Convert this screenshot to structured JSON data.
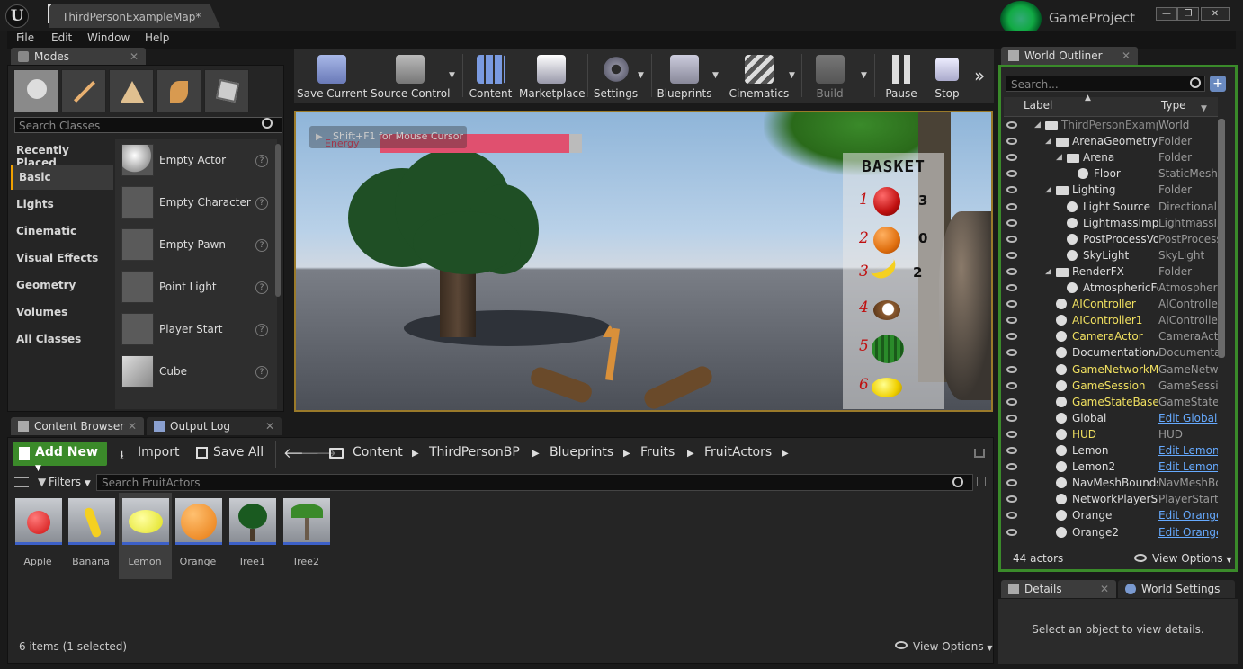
{
  "window": {
    "doc_tab": "ThirdPersonExampleMap*",
    "project": "GameProject",
    "controls": [
      "—",
      "❐",
      "✕"
    ]
  },
  "menu": [
    "File",
    "Edit",
    "Window",
    "Help"
  ],
  "modes": {
    "tab": "Modes",
    "search_placeholder": "Search Classes",
    "categories": [
      "Recently Placed",
      "Basic",
      "Lights",
      "Cinematic",
      "Visual Effects",
      "Geometry",
      "Volumes",
      "All Classes"
    ],
    "selected_category": "Basic",
    "items": [
      "Empty Actor",
      "Empty Character",
      "Empty Pawn",
      "Point Light",
      "Player Start",
      "Cube"
    ]
  },
  "toolbar": {
    "buttons": [
      "Save Current",
      "Source Control",
      "Content",
      "Marketplace",
      "Settings",
      "Blueprints",
      "Cinematics",
      "Build",
      "Pause",
      "Stop"
    ]
  },
  "viewport": {
    "hint": "Shift+F1 for Mouse Cursor",
    "energy_label": "Energy",
    "energy_level": 0.96,
    "basket": {
      "title": "BASKET",
      "rows": [
        {
          "num": "1",
          "count": "3",
          "fruit": "apple"
        },
        {
          "num": "2",
          "count": "0",
          "fruit": "orange"
        },
        {
          "num": "3",
          "count": "2",
          "fruit": "banana"
        },
        {
          "num": "4",
          "count": "",
          "fruit": "coconut"
        },
        {
          "num": "5",
          "count": "",
          "fruit": "watermelon"
        },
        {
          "num": "6",
          "count": "",
          "fruit": "lemon"
        }
      ]
    }
  },
  "content_browser": {
    "tabs": [
      "Content Browser",
      "Output Log"
    ],
    "add_new": "Add New",
    "import": "Import",
    "save_all": "Save All",
    "breadcrumb": [
      "Content",
      "ThirdPersonBP",
      "Blueprints",
      "Fruits",
      "FruitActors"
    ],
    "filters": "Filters",
    "search_placeholder": "Search FruitActors",
    "assets": [
      "Apple",
      "Banana",
      "Lemon",
      "Orange",
      "Tree1",
      "Tree2"
    ],
    "selected_asset": "Lemon",
    "status": "6 items (1 selected)",
    "view_options": "View Options"
  },
  "outliner": {
    "tab": "World Outliner",
    "search_placeholder": "Search...",
    "col_label": "Label",
    "col_type": "Type",
    "rows": [
      {
        "label": "ThirdPersonExampleMap",
        "type": "World",
        "indent": 3,
        "dim": true
      },
      {
        "label": "ArenaGeometry",
        "type": "Folder",
        "indent": 4
      },
      {
        "label": "Arena",
        "type": "Folder",
        "indent": 5
      },
      {
        "label": "Floor",
        "type": "StaticMeshActor",
        "indent": 6
      },
      {
        "label": "Lighting",
        "type": "Folder",
        "indent": 4
      },
      {
        "label": "Light Source",
        "type": "DirectionalLight",
        "indent": 5
      },
      {
        "label": "LightmassImportanceVolume",
        "type": "LightmassImportanceVolume",
        "indent": 5
      },
      {
        "label": "PostProcessVolume",
        "type": "PostProcessVolume",
        "indent": 5
      },
      {
        "label": "SkyLight",
        "type": "SkyLight",
        "indent": 5
      },
      {
        "label": "RenderFX",
        "type": "Folder",
        "indent": 4
      },
      {
        "label": "AtmosphericFog",
        "type": "AtmosphericFog",
        "indent": 5
      },
      {
        "label": "AIController",
        "type": "AIController",
        "indent": 4,
        "yellow": true
      },
      {
        "label": "AIController1",
        "type": "AIController",
        "indent": 4,
        "yellow": true
      },
      {
        "label": "CameraActor",
        "type": "CameraActor",
        "indent": 4,
        "yellow": true
      },
      {
        "label": "DocumentationActor",
        "type": "DocumentationActor",
        "indent": 4
      },
      {
        "label": "GameNetworkManager",
        "type": "GameNetworkManager",
        "indent": 4,
        "yellow": true
      },
      {
        "label": "GameSession",
        "type": "GameSession",
        "indent": 4,
        "yellow": true
      },
      {
        "label": "GameStateBase",
        "type": "GameStateBase",
        "indent": 4,
        "yellow": true
      },
      {
        "label": "Global",
        "type": "Edit Global",
        "indent": 4,
        "link": true
      },
      {
        "label": "HUD",
        "type": "HUD",
        "indent": 4,
        "yellow": true
      },
      {
        "label": "Lemon",
        "type": "Edit Lemon",
        "indent": 4,
        "link": true
      },
      {
        "label": "Lemon2",
        "type": "Edit Lemon",
        "indent": 4,
        "link": true
      },
      {
        "label": "NavMeshBoundsVolume",
        "type": "NavMeshBoundsVolume",
        "indent": 4
      },
      {
        "label": "NetworkPlayerStart",
        "type": "PlayerStart",
        "indent": 4
      },
      {
        "label": "Orange",
        "type": "Edit Orange",
        "indent": 4,
        "link": true
      },
      {
        "label": "Orange2",
        "type": "Edit Orange",
        "indent": 4,
        "link": true
      }
    ],
    "actor_count": "44 actors",
    "view_options": "View Options"
  },
  "details": {
    "tab": "Details",
    "world_settings_tab": "World Settings",
    "empty_message": "Select an object to view details."
  },
  "colors": {
    "accent_orange": "#f0a000",
    "add_new_green": "#3b8a2a",
    "outliner_border_green": "#3a8a2a",
    "link_blue": "#66aaff",
    "actor_yellow": "#f0e060"
  }
}
